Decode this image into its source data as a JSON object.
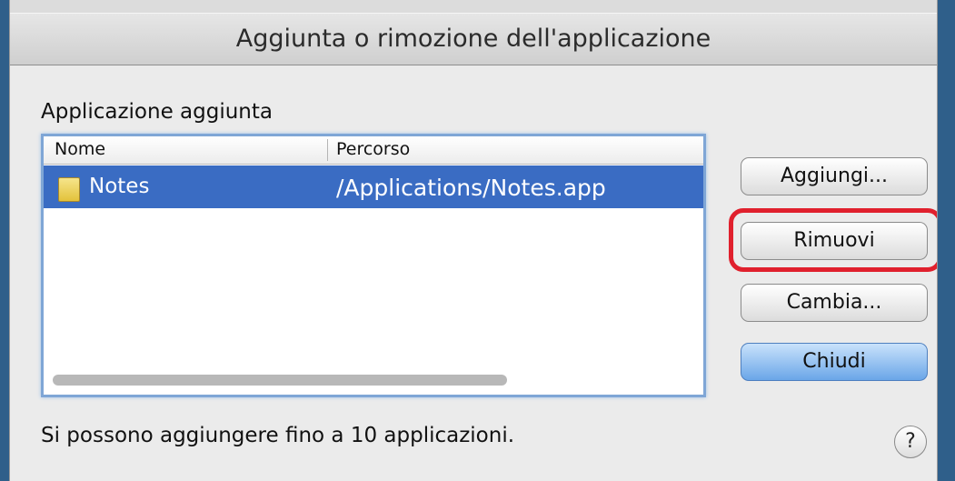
{
  "window": {
    "title": "Aggiunta o rimozione dell'applicazione"
  },
  "section": {
    "label": "Applicazione aggiunta"
  },
  "table": {
    "columns": [
      "Nome",
      "Percorso"
    ],
    "rows": [
      {
        "name": "Notes",
        "path": "/Applications/Notes.app",
        "icon": "notes-app-icon",
        "selected": true
      }
    ]
  },
  "buttons": {
    "add": "Aggiungi...",
    "remove": "Rimuovi",
    "change": "Cambia...",
    "close": "Chiudi",
    "help": "?"
  },
  "footer": {
    "text": "Si possono aggiungere fino a 10 applicazioni."
  },
  "colors": {
    "selection": "#3a6cc3",
    "default_button": "#6aa6e8",
    "highlight_ring": "#e0202d"
  }
}
